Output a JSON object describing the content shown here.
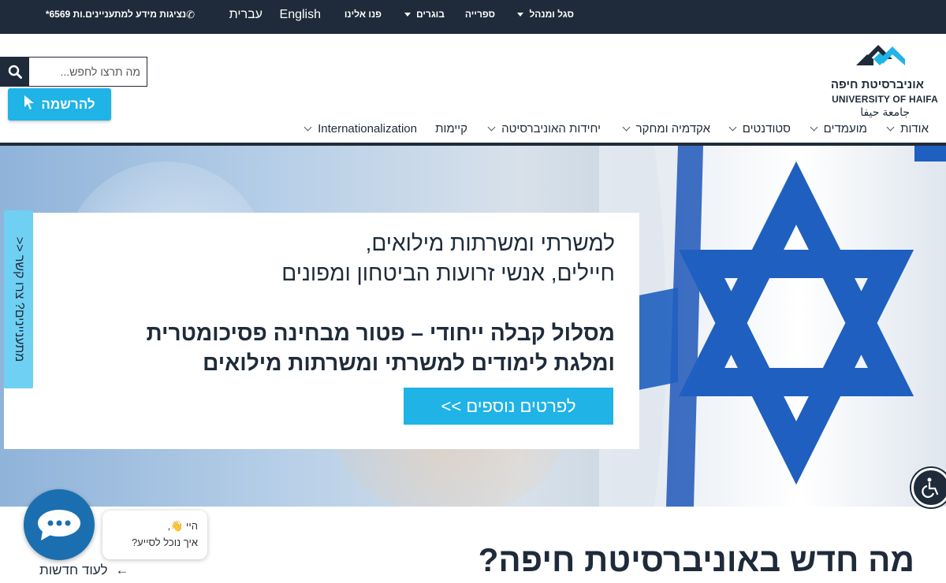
{
  "topbar": {
    "staff_menu": "סגל ומנהל",
    "library": "ספרייה",
    "alumni": "בוגרים",
    "contact": "פנו אלינו",
    "english": "English",
    "hebrew": "עברית",
    "phone_text": "נציגות מידע למתעניינים.ות 6569*"
  },
  "logo": {
    "hebrew": "אוניברסיטת חיפה",
    "english": "UNIVERSITY OF HAIFA",
    "arabic": "جامعة حيفا"
  },
  "search": {
    "placeholder": "מה תרצו לחפש..."
  },
  "register_label": "להרשמה",
  "nav": [
    "אודות",
    "מועמדים",
    "סטודנטים",
    "אקדמיה ומחקר",
    "יחידות האוניברסיטה",
    "קיימות",
    "Internationalization"
  ],
  "side_tab": "מתעניינים? צרו קשר <<",
  "hero": {
    "line1": "למשרתי ומשרתות מילואים,",
    "line2": "חיילים, אנשי זרועות הביטחון ומפונים",
    "bold1": "מסלול קבלה ייחודי – פטור מבחינה פסיכומטרית",
    "bold2": "ומלגת לימודים למשרתי ומשרתות מילואים",
    "cta": "לפרטים נוספים >>"
  },
  "news": {
    "title": "מה חדש באוניברסיטת חיפה?",
    "more": "לעוד חדשות"
  },
  "chat": {
    "greeting": "היי 👋,",
    "question": "איך נוכל לסייע?"
  },
  "colors": {
    "navy": "#1f2b3a",
    "accent": "#1fb3e6",
    "flag_blue": "#1f5fbf"
  }
}
